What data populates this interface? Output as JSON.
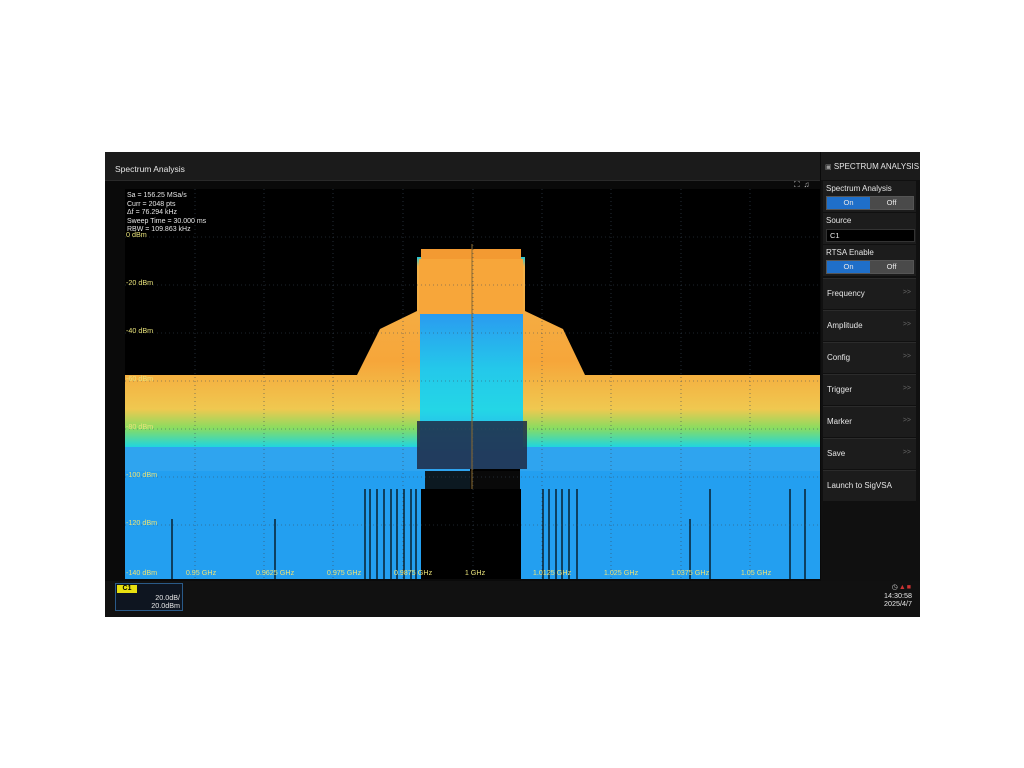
{
  "window": {
    "title": "Spectrum Analysis"
  },
  "plot": {
    "corner_icons": [
      "fullscreen-icon",
      "note-icon"
    ],
    "info": {
      "sa": "Sa = 156.25 MSa/s",
      "curr": "Curr = 2048 pts",
      "df": "Δf = 76.294 kHz",
      "sweep": "Sweep Time = 30.000 ms",
      "rbw": "RBW = 109.863 kHz"
    },
    "y_labels": [
      "0 dBm",
      "-20 dBm",
      "-40 dBm",
      "-60 dBm",
      "-80 dBm",
      "-100 dBm",
      "-120 dBm",
      "-140 dBm"
    ],
    "x_labels": [
      "0.95 GHz",
      "0.9625 GHz",
      "0.975 GHz",
      "0.9875 GHz",
      "1 GHz",
      "1.0125 GHz",
      "1.025 GHz",
      "1.0375 GHz",
      "1.05 GHz"
    ]
  },
  "sidebar": {
    "header": "SPECTRUM ANALYSIS",
    "spectrum_analysis": {
      "label": "Spectrum Analysis",
      "on": "On",
      "off": "Off",
      "state": "On"
    },
    "source": {
      "label": "Source",
      "value": "C1"
    },
    "rtsa": {
      "label": "RTSA Enable",
      "on": "On",
      "off": "Off",
      "state": "On"
    },
    "menu": [
      "Frequency",
      "Amplitude",
      "Config",
      "Trigger",
      "Marker",
      "Save",
      "Launch to SigVSA"
    ],
    "chevron": ">>"
  },
  "channel": {
    "tag": "C1",
    "scale": "20.0dB/",
    "offset": "20.0dBm"
  },
  "status": {
    "time": "14:30:58",
    "date": "2025/4/7"
  },
  "colors": {
    "accent": "#1f6fc9",
    "label_yellow": "#e8e27a",
    "channel_yellow": "#e8e010"
  }
}
